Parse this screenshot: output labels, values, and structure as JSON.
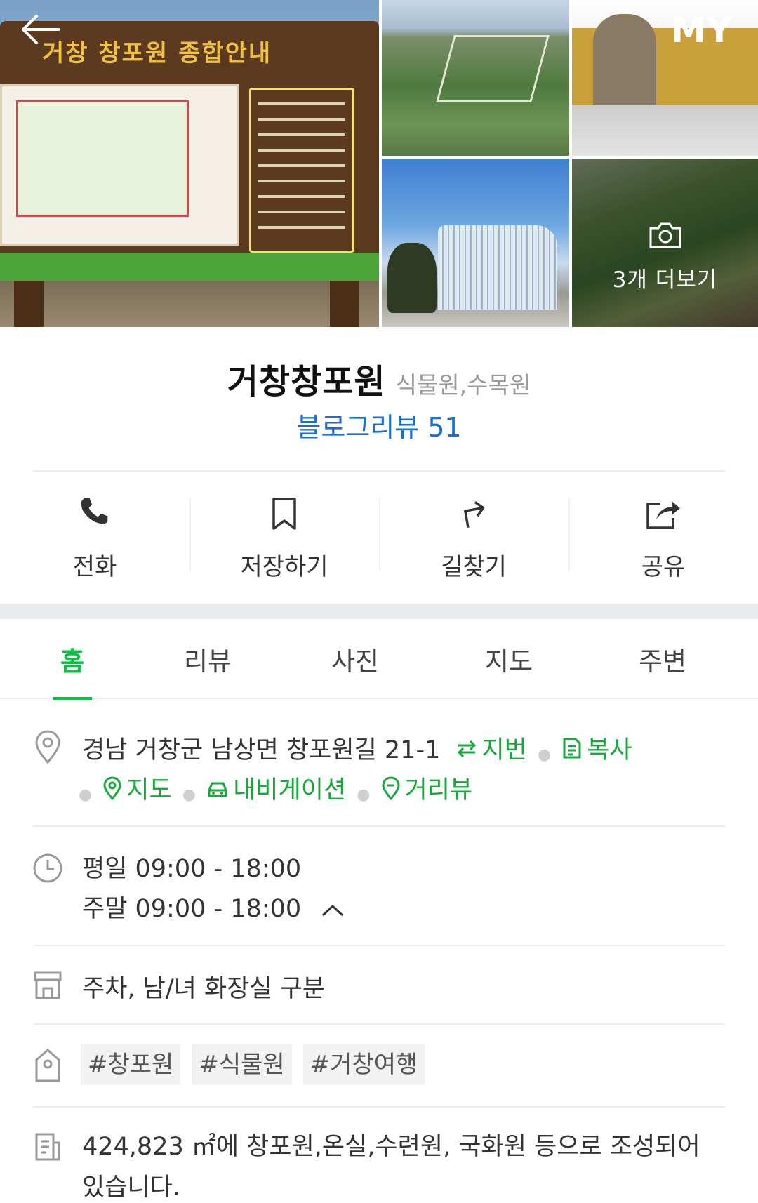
{
  "header": {
    "back_label": "뒤로",
    "my_label": "MY",
    "more_photos_label": "3개 더보기",
    "sign_title": "거창 창포원 종합안내"
  },
  "place": {
    "name": "거창창포원",
    "category": "식물원,수목원",
    "blog_review": "블로그리뷰 51"
  },
  "actions": [
    {
      "label": "전화",
      "icon": "phone-icon"
    },
    {
      "label": "저장하기",
      "icon": "bookmark-icon"
    },
    {
      "label": "길찾기",
      "icon": "directions-icon"
    },
    {
      "label": "공유",
      "icon": "share-icon"
    }
  ],
  "tabs": [
    {
      "label": "홈",
      "active": true
    },
    {
      "label": "리뷰",
      "active": false
    },
    {
      "label": "사진",
      "active": false
    },
    {
      "label": "지도",
      "active": false
    },
    {
      "label": "주변",
      "active": false
    }
  ],
  "address": {
    "text": "경남 거창군 남상면 창포원길 21-1",
    "jibun_label": "지번",
    "copy_label": "복사",
    "map_label": "지도",
    "navigation_label": "내비게이션",
    "streetview_label": "거리뷰"
  },
  "hours": {
    "weekday": "평일 09:00 - 18:00",
    "weekend": "주말 09:00 - 18:00"
  },
  "facilities": "주차, 남/녀 화장실 구분",
  "tags": [
    "#창포원",
    "#식물원",
    "#거창여행"
  ],
  "description": "424,823 ㎡에 창포원,온실,수련원, 국화원 등으로 조성되어 있습니다.",
  "colors": {
    "accent_green": "#00c73c",
    "link_green": "#18a83c",
    "blog_blue": "#1a6dd6"
  }
}
